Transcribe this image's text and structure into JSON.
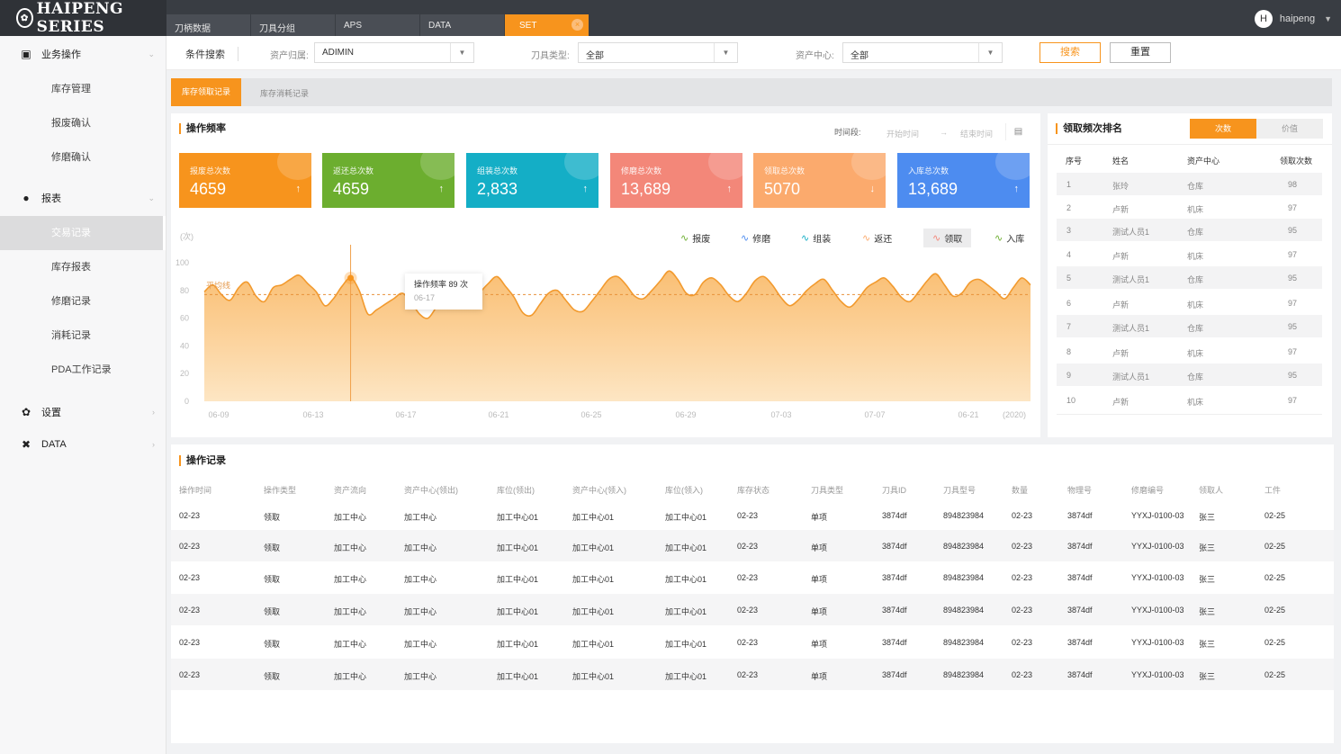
{
  "app": {
    "logo": "HAIPENG SERIES"
  },
  "tabs": [
    {
      "label": "刀柄数据"
    },
    {
      "label": "刀具分组"
    },
    {
      "label": "APS"
    },
    {
      "label": "DATA"
    },
    {
      "label": "SET",
      "active": true
    }
  ],
  "user": {
    "initial": "H",
    "name": "haipeng"
  },
  "sidebar": {
    "groups": [
      {
        "label": "业务操作",
        "icon": "briefcase-icon"
      },
      {
        "label": "报表",
        "icon": "report-icon"
      },
      {
        "label": "设置",
        "icon": "gear-icon"
      },
      {
        "label": "DATA",
        "icon": "data-icon"
      }
    ],
    "biz_items": [
      "库存管理",
      "报废确认",
      "修磨确认"
    ],
    "report_items": [
      "交易记录",
      "库存报表",
      "修磨记录",
      "消耗记录",
      "PDA工作记录"
    ]
  },
  "filter": {
    "title": "条件搜索",
    "owner_label": "资产归属:",
    "owner_value": "ADIMIN",
    "tooltype_label": "刀具类型:",
    "tooltype_value": "全部",
    "center_label": "资产中心:",
    "center_value": "全部",
    "search_btn": "搜索",
    "reset_btn": "重置"
  },
  "subtabs": [
    "库存领取记录",
    "库存消耗记录"
  ],
  "freq": {
    "title": "操作频率",
    "period_label": "时间段:",
    "start_placeholder": "开始时间",
    "end_placeholder": "结束时间",
    "arrow": "→"
  },
  "stats": [
    {
      "label": "报废总次数",
      "value": "4659",
      "arrow": "↑",
      "color": "#f7941d"
    },
    {
      "label": "返还总次数",
      "value": "4659",
      "arrow": "↑",
      "color": "#6cae2f"
    },
    {
      "label": "组装总次数",
      "value": "2,833",
      "arrow": "↑",
      "color": "#14aec6"
    },
    {
      "label": "修磨总次数",
      "value": "13,689",
      "arrow": "↑",
      "color": "#f38779"
    },
    {
      "label": "领取总次数",
      "value": "5070",
      "arrow": "↓",
      "color": "#fbaa6d"
    },
    {
      "label": "入库总次数",
      "value": "13,689",
      "arrow": "↑",
      "color": "#4d8cf0"
    }
  ],
  "legend": [
    {
      "label": "报废",
      "color": "#6cae2f"
    },
    {
      "label": "修磨",
      "color": "#4d8cf0"
    },
    {
      "label": "组装",
      "color": "#14aec6"
    },
    {
      "label": "返还",
      "color": "#fbaa6d"
    },
    {
      "label": "领取",
      "color": "#f38779"
    },
    {
      "label": "入库",
      "color": "#6cae2f"
    }
  ],
  "tooltip": {
    "title": "操作频率 89 次",
    "date": "06-17"
  },
  "avg_label": "平均线",
  "chart_data": {
    "type": "area",
    "ylabel": "(次)",
    "ylim": [
      0,
      100
    ],
    "yticks": [
      0,
      20,
      40,
      60,
      80,
      100
    ],
    "xtick_labels": [
      "06-09",
      "06-13",
      "06-17",
      "06-21",
      "06-25",
      "06-29",
      "07-03",
      "07-07",
      "06-21",
      "(2020)"
    ],
    "average": 77,
    "series": [
      {
        "values": [
          79,
          84,
          77,
          73,
          82,
          86,
          76,
          72,
          82,
          84,
          88,
          91,
          85,
          79,
          69,
          74,
          83,
          89,
          80,
          63,
          66,
          70,
          74,
          78,
          72,
          63,
          60,
          68,
          73,
          76,
          72,
          68,
          78,
          85,
          90,
          83,
          75,
          64,
          62,
          70,
          78,
          80,
          73,
          66,
          65,
          72,
          80,
          88,
          90,
          84,
          76,
          74,
          80,
          87,
          94,
          88,
          78,
          77,
          86,
          89,
          84,
          76,
          72,
          78,
          87,
          90,
          84,
          75,
          69,
          73,
          80,
          85,
          88,
          80,
          72,
          68,
          74,
          82,
          86,
          89,
          83,
          75,
          72,
          79,
          87,
          92,
          84,
          76,
          78,
          86,
          88,
          84,
          79,
          74,
          82,
          89,
          84
        ]
      }
    ]
  },
  "rank": {
    "title": "领取频次排名",
    "toggle": [
      "次数",
      "价值"
    ],
    "headers": [
      "序号",
      "姓名",
      "资产中心",
      "领取次数"
    ],
    "rows": [
      [
        "1",
        "张玲",
        "仓库",
        "98"
      ],
      [
        "2",
        "卢新",
        "机床",
        "97"
      ],
      [
        "3",
        "测试人员1",
        "仓库",
        "95"
      ],
      [
        "4",
        "卢新",
        "机床",
        "97"
      ],
      [
        "5",
        "测试人员1",
        "仓库",
        "95"
      ],
      [
        "6",
        "卢新",
        "机床",
        "97"
      ],
      [
        "7",
        "测试人员1",
        "仓库",
        "95"
      ],
      [
        "8",
        "卢新",
        "机床",
        "97"
      ],
      [
        "9",
        "测试人员1",
        "仓库",
        "95"
      ],
      [
        "10",
        "卢新",
        "机床",
        "97"
      ]
    ]
  },
  "records": {
    "title": "操作记录",
    "headers": [
      "操作时间",
      "操作类型",
      "资产流向",
      "资产中心(领出)",
      "库位(领出)",
      "资产中心(领入)",
      "库位(领入)",
      "库存状态",
      "刀具类型",
      "刀具ID",
      "刀具型号",
      "数量",
      "物理号",
      "修磨编号",
      "领取人",
      "工件"
    ],
    "rows": [
      [
        "02-23",
        "领取",
        "加工中心",
        "加工中心",
        "加工中心01",
        "加工中心01",
        "加工中心01",
        "02-23",
        "单项",
        "3874df",
        "894823984",
        "02-23",
        "3874df",
        "YYXJ-0100-03",
        "张三",
        "02-25"
      ],
      [
        "02-23",
        "领取",
        "加工中心",
        "加工中心",
        "加工中心01",
        "加工中心01",
        "加工中心01",
        "02-23",
        "单项",
        "3874df",
        "894823984",
        "02-23",
        "3874df",
        "YYXJ-0100-03",
        "张三",
        "02-25"
      ],
      [
        "02-23",
        "领取",
        "加工中心",
        "加工中心",
        "加工中心01",
        "加工中心01",
        "加工中心01",
        "02-23",
        "单项",
        "3874df",
        "894823984",
        "02-23",
        "3874df",
        "YYXJ-0100-03",
        "张三",
        "02-25"
      ],
      [
        "02-23",
        "领取",
        "加工中心",
        "加工中心",
        "加工中心01",
        "加工中心01",
        "加工中心01",
        "02-23",
        "单项",
        "3874df",
        "894823984",
        "02-23",
        "3874df",
        "YYXJ-0100-03",
        "张三",
        "02-25"
      ],
      [
        "02-23",
        "领取",
        "加工中心",
        "加工中心",
        "加工中心01",
        "加工中心01",
        "加工中心01",
        "02-23",
        "单项",
        "3874df",
        "894823984",
        "02-23",
        "3874df",
        "YYXJ-0100-03",
        "张三",
        "02-25"
      ],
      [
        "02-23",
        "领取",
        "加工中心",
        "加工中心",
        "加工中心01",
        "加工中心01",
        "加工中心01",
        "02-23",
        "单项",
        "3874df",
        "894823984",
        "02-23",
        "3874df",
        "YYXJ-0100-03",
        "张三",
        "02-25"
      ]
    ]
  }
}
